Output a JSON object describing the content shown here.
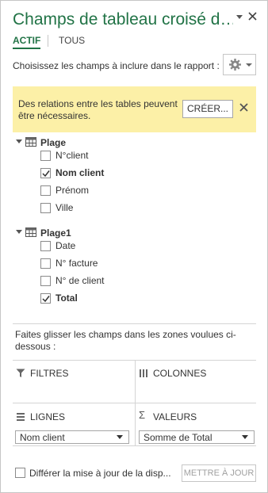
{
  "pane": {
    "title": "Champs de tableau croisé d…",
    "accent_color": "#217346",
    "menu_icon": "dropdown-arrow-icon",
    "close_icon": "close-icon"
  },
  "tabs": [
    {
      "label": "ACTIF",
      "selected": true
    },
    {
      "label": "TOUS",
      "selected": false
    }
  ],
  "choose_fields_text": "Choisissez les champs à inclure dans le rapport :",
  "tools_button": {
    "icon": "gear-icon"
  },
  "banner": {
    "text": "Des relations entre les tables peuvent être nécessaires.",
    "button_label": "CRÉER...",
    "background": "#fcf0a7"
  },
  "tables": [
    {
      "name": "Plage",
      "fields": [
        {
          "label": "N°client",
          "checked": false
        },
        {
          "label": "Nom client",
          "checked": true
        },
        {
          "label": "Prénom",
          "checked": false
        },
        {
          "label": "Ville",
          "checked": false
        }
      ]
    },
    {
      "name": "Plage1",
      "fields": [
        {
          "label": "Date",
          "checked": false
        },
        {
          "label": "N° facture",
          "checked": false
        },
        {
          "label": "N° de client",
          "checked": false
        },
        {
          "label": "Total",
          "checked": true
        }
      ]
    }
  ],
  "drag_instructions": "Faites glisser les champs dans les zones voulues ci-dessous :",
  "zones": {
    "filters": {
      "label": "FILTRES",
      "icon": "filter-icon"
    },
    "columns": {
      "label": "COLONNES",
      "icon": "columns-icon"
    },
    "rows": {
      "label": "LIGNES",
      "icon": "rows-icon",
      "value": "Nom client"
    },
    "values": {
      "label": "VALEURS",
      "icon": "sigma-icon",
      "value": "Somme de Total"
    }
  },
  "defer_update": {
    "label": "Différer la mise à jour de la disp...",
    "checked": false
  },
  "update_button_label": "METTRE À JOUR"
}
